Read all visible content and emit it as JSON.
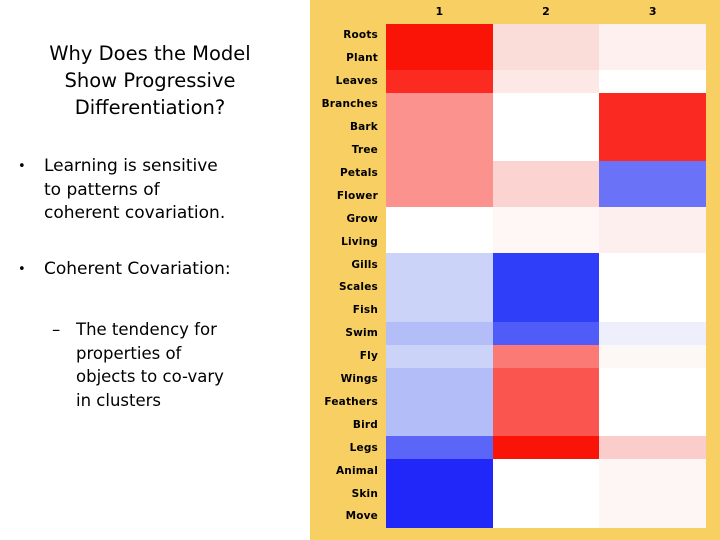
{
  "slide": {
    "title": "Why Does the Model\nShow Progressive\nDifferentiation?",
    "bullets": [
      {
        "marker": "•",
        "text": "Learning is sensitive\nto patterns of\ncoherent covariation."
      },
      {
        "marker": "•",
        "text": "Coherent Covariation:"
      },
      {
        "marker": "–",
        "text": "The tendency for\nproperties of\nobjects to co-vary\nin clusters"
      }
    ]
  },
  "panel": {
    "background_color": "#f7cf63"
  },
  "chart_data": {
    "type": "heatmap",
    "title": "",
    "xlabel": "",
    "ylabel": "",
    "grid": false,
    "legend": "none",
    "columns": [
      "1",
      "2",
      "3"
    ],
    "rows": [
      "Roots",
      "Plant",
      "Leaves",
      "Branches",
      "Bark",
      "Tree",
      "Petals",
      "Flower",
      "Grow",
      "Living",
      "Gills",
      "Scales",
      "Fish",
      "Swim",
      "Fly",
      "Wings",
      "Feathers",
      "Bird",
      "Legs",
      "Animal",
      "Skin",
      "Move"
    ],
    "colormap": "blue-white-red",
    "colors": [
      [
        "#fa1408",
        "#fadcd8",
        "#fdf0ee"
      ],
      [
        "#fa1408",
        "#fadcd8",
        "#fdf0ee"
      ],
      [
        "#fb2b22",
        "#fce9e6",
        "#ffffff"
      ],
      [
        "#fb928e",
        "#ffffff",
        "#fa2a22"
      ],
      [
        "#fb928e",
        "#ffffff",
        "#fa2a22"
      ],
      [
        "#fb928e",
        "#ffffff",
        "#fa2a22"
      ],
      [
        "#fb928e",
        "#fbd3d0",
        "#6a72f8"
      ],
      [
        "#fb928e",
        "#fbd3d0",
        "#6a72f8"
      ],
      [
        "#ffffff",
        "#fef7f6",
        "#fdefee"
      ],
      [
        "#ffffff",
        "#fef7f6",
        "#fdefee"
      ],
      [
        "#ccd3f8",
        "#2f3ef8",
        "#ffffff"
      ],
      [
        "#ccd3f8",
        "#2f3ef8",
        "#ffffff"
      ],
      [
        "#ccd3f8",
        "#2f3ef8",
        "#ffffff"
      ],
      [
        "#b3bdf8",
        "#4f5cf8",
        "#edf0fc"
      ],
      [
        "#ccd3f8",
        "#fc7a75",
        "#fdf7f6"
      ],
      [
        "#b3bdf8",
        "#fb5550",
        "#ffffff"
      ],
      [
        "#b3bdf8",
        "#fb5550",
        "#ffffff"
      ],
      [
        "#b3bdf8",
        "#fb5550",
        "#ffffff"
      ],
      [
        "#5b66f8",
        "#fa1408",
        "#fbcdca"
      ],
      [
        "#2027f8",
        "#ffffff",
        "#fdf6f5"
      ],
      [
        "#2027f8",
        "#ffffff",
        "#fdf6f5"
      ],
      [
        "#2027f8",
        "#ffffff",
        "#fdf6f5"
      ]
    ],
    "values": [
      [
        1.0,
        0.14,
        0.06
      ],
      [
        1.0,
        0.14,
        0.06
      ],
      [
        0.95,
        0.09,
        0.0
      ],
      [
        0.55,
        0.0,
        0.95
      ],
      [
        0.55,
        0.0,
        0.95
      ],
      [
        0.55,
        0.0,
        0.95
      ],
      [
        0.55,
        0.18,
        -0.62
      ],
      [
        0.55,
        0.18,
        -0.62
      ],
      [
        0.0,
        0.03,
        0.07
      ],
      [
        0.0,
        0.03,
        0.07
      ],
      [
        -0.2,
        -0.82,
        0.0
      ],
      [
        -0.2,
        -0.82,
        0.0
      ],
      [
        -0.2,
        -0.82,
        0.0
      ],
      [
        -0.3,
        -0.7,
        -0.08
      ],
      [
        -0.2,
        0.52,
        0.03
      ],
      [
        -0.3,
        0.68,
        0.0
      ],
      [
        -0.3,
        0.68,
        0.0
      ],
      [
        -0.3,
        0.68,
        0.0
      ],
      [
        -0.65,
        1.0,
        0.2
      ],
      [
        -0.88,
        0.0,
        0.04
      ],
      [
        -0.88,
        0.0,
        0.04
      ],
      [
        -0.88,
        0.0,
        0.04
      ]
    ]
  }
}
